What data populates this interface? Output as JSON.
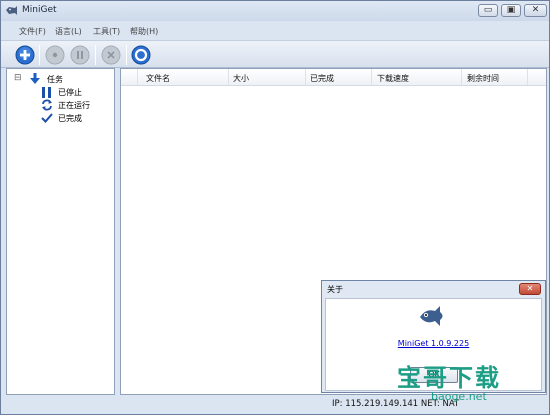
{
  "window": {
    "title": "MiniGet"
  },
  "window_buttons": {
    "minimize": "▭",
    "maximize": "▣",
    "close": "✕"
  },
  "menu": [
    "文件(F)",
    "语言(L)",
    "工具(T)",
    "帮助(H)"
  ],
  "toolbar": {
    "buttons": [
      "add-icon",
      "record-icon",
      "pause-icon",
      "cancel-icon",
      "settings-icon"
    ],
    "colors": {
      "add": "#2a6fd1",
      "disabled": "#b7bec8",
      "settings": "#2a6fd1"
    }
  },
  "sidebar": {
    "expander": "⊟",
    "root": "任务",
    "items": [
      "已停止",
      "正在运行",
      "已完成"
    ]
  },
  "list": {
    "columns": [
      "文件名",
      "大小",
      "已完成",
      "下载速度",
      "剩余时间"
    ]
  },
  "status": {
    "text": "IP: 115.219.149.141  NET: NAT"
  },
  "about_dialog": {
    "title": "关于",
    "close": "✕",
    "version_link": "MiniGet 1.0.9.225",
    "ok": "OK"
  },
  "watermark": {
    "main": "宝哥下载",
    "sub": "baoge.net"
  }
}
